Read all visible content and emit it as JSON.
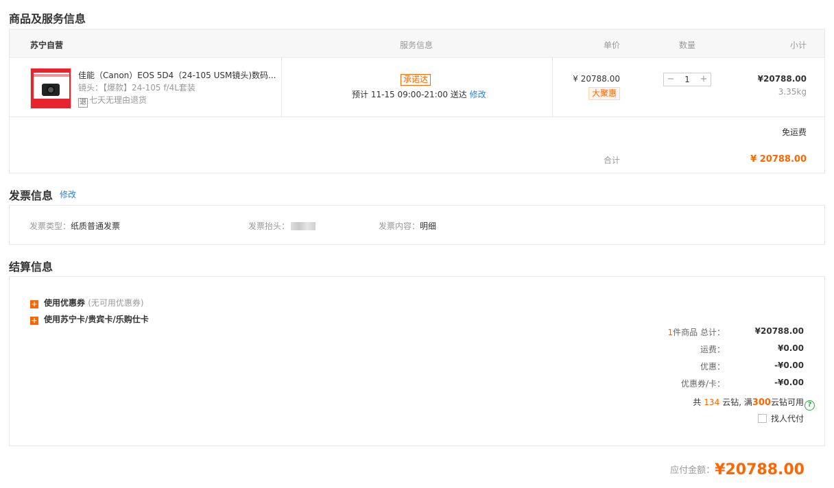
{
  "goods": {
    "title": "商品及服务信息",
    "headers": {
      "store": "苏宁自营",
      "service": "服务信息",
      "price": "单价",
      "qty": "数量",
      "subtotal": "小计"
    },
    "item": {
      "name": "佳能（Canon）EOS 5D4（24-105 USM镜头)数码...",
      "lens_label": "镜头：",
      "lens_value": "【爆款】24-105 f/4L套装",
      "return_icon": "退",
      "return_text": "七天无理由退货",
      "promise": "承诺达",
      "eta": "预计 11-15 09:00-21:00 送达",
      "eta_edit": "修改",
      "unit_price": "¥ 20788.00",
      "badge": "大聚惠",
      "qty": "1",
      "qty_minus": "−",
      "qty_plus": "+",
      "subtotal": "¥20788.00",
      "weight": "3.35kg"
    },
    "shipping": "免运费",
    "total_label": "合计",
    "total_value": "¥ 20788.00"
  },
  "invoice": {
    "title": "发票信息",
    "edit": "修改",
    "type_label": "发票类型：",
    "type_value": "纸质普通发票",
    "header_label": "发票抬头：",
    "content_label": "发票内容：",
    "content_value": "明细"
  },
  "settlement": {
    "title": "结算信息",
    "coupon_label": "使用优惠券",
    "coupon_note": "(无可用优惠券)",
    "card_label": "使用苏宁卡/贵宾卡/乐购仕卡",
    "summary": {
      "count": "1",
      "total_label": "件商品  总计：",
      "total_value": "¥20788.00",
      "freight_label": "运费：",
      "freight_value": "¥0.00",
      "discount_label": "优惠：",
      "discount_value": "-¥0.00",
      "coupon_label": "优惠券/卡：",
      "coupon_value": "-¥0.00"
    },
    "diamonds_prefix": "共",
    "diamonds_count": "134",
    "diamonds_mid": "云钻, 满",
    "diamonds_threshold": "300",
    "diamonds_suffix": "云钻可用",
    "proxy_pay": "找人代付"
  },
  "pay": {
    "label": "应付金额：",
    "value": "¥20788.00"
  },
  "colors": {
    "accent": "#ff6600",
    "link": "#2e7dd1",
    "help": "#2aa845"
  }
}
